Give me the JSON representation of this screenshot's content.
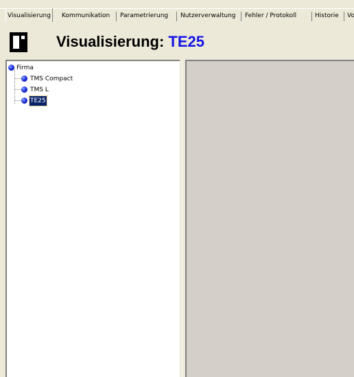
{
  "tabs": [
    {
      "label": "Visualisierung",
      "active": true
    },
    {
      "label": "Kommunikation",
      "active": false
    },
    {
      "label": "Parametrierung",
      "active": false
    },
    {
      "label": "Nutzerverwaltung",
      "active": false
    },
    {
      "label": "Fehler / Protokoll",
      "active": false
    },
    {
      "label": "Historie",
      "active": false
    },
    {
      "label": "Vo",
      "active": false
    }
  ],
  "header": {
    "title_prefix": "Visualisierung: ",
    "title_device": "TE25",
    "accent_color": "#1414e6"
  },
  "tree": {
    "root": {
      "label": "Firma",
      "icon": "blue-dot-icon"
    },
    "children": [
      {
        "label": "TMS Compact",
        "icon": "blue-dot-icon",
        "selected": false
      },
      {
        "label": "TMS L",
        "icon": "blue-dot-icon",
        "selected": false
      },
      {
        "label": "TE25",
        "icon": "blue-dot-icon",
        "selected": true
      }
    ]
  }
}
